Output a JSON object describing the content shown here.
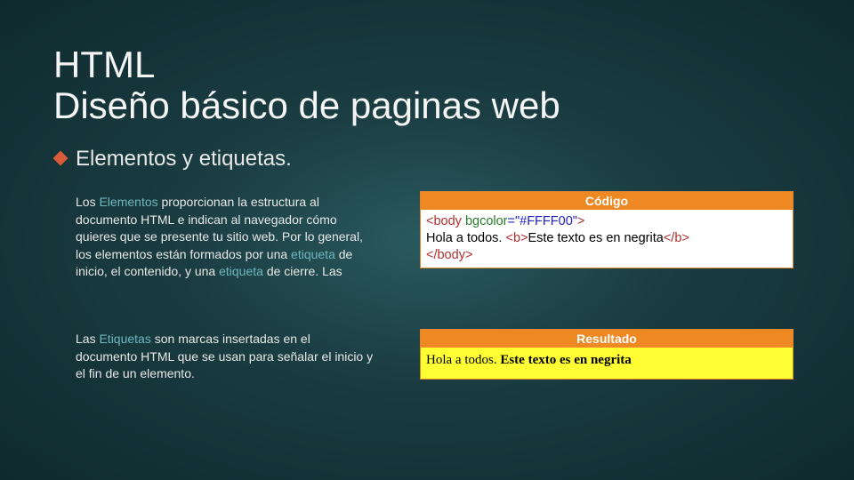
{
  "title": {
    "line1": "HTML",
    "line2": "Diseño básico de paginas web"
  },
  "subheading": "Elementos y etiquetas.",
  "para1": {
    "prefix": "Los ",
    "hl1": "Elementos",
    "mid1": " proporcionan la estructura al documento HTML e indican al navegador cómo quieres que se presente tu sitio web. Por lo general, los elementos están formados por una ",
    "hl2": "etiqueta",
    "mid2": " de inicio, el contenido, y una ",
    "hl3": "etiqueta",
    "suffix": " de cierre. Las"
  },
  "para2": {
    "prefix": "Las ",
    "hl1": "Etiquetas",
    "suffix": " son marcas insertadas en el documento HTML que se usan para señalar el inicio y el fin de un elemento."
  },
  "codebox": {
    "header": "Código",
    "line1_tag": "<body",
    "line1_attr": " bgcolor",
    "line1_val": "=\"#FFFF00\"",
    "line1_close": ">",
    "line2_pre": "Hola a todos. ",
    "line2_b_open": "<b>",
    "line2_bold": "Este texto es en negrita",
    "line2_b_close": "</b>",
    "line3": "</body>"
  },
  "resultbox": {
    "header": "Resultado",
    "text_plain": "Hola a todos. ",
    "text_bold": "Este texto es en negrita"
  }
}
